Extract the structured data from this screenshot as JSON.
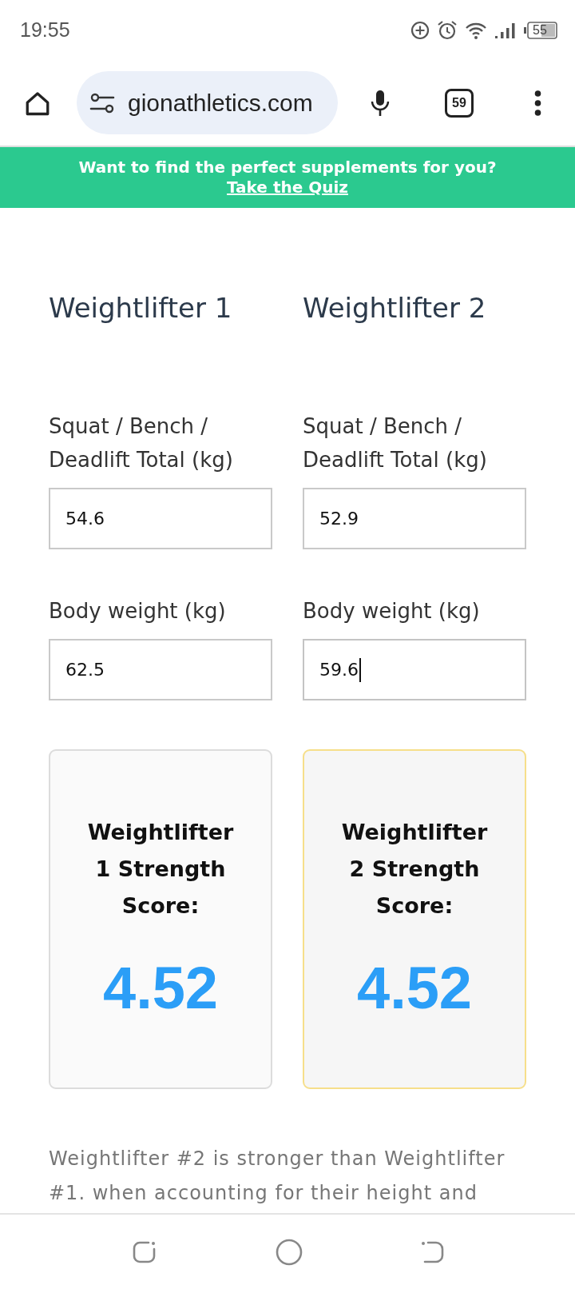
{
  "status_bar": {
    "time": "19:55",
    "battery": "55"
  },
  "browser": {
    "url": "gionathletics.com",
    "tab_count": "59"
  },
  "banner": {
    "text": "Want to find the perfect supplements for you?",
    "link": "Take the Quiz"
  },
  "lifters": [
    {
      "heading": "Weightlifter 1",
      "fields": [
        {
          "label": "Squat / Bench / Deadlift Total (kg)",
          "value": "54.6",
          "focused": false
        },
        {
          "label": "Body weight (kg)",
          "value": "62.5",
          "focused": false
        }
      ],
      "result": {
        "title": "Weightlifter 1 Strength Score:",
        "score": "4.52",
        "highlighted": false
      }
    },
    {
      "heading": "Weightlifter 2",
      "fields": [
        {
          "label": "Squat / Bench / Deadlift Total (kg)",
          "value": "52.9",
          "focused": false
        },
        {
          "label": "Body weight (kg)",
          "value": "59.6",
          "focused": true
        }
      ],
      "result": {
        "title": "Weightlifter 2 Strength Score:",
        "score": "4.52",
        "highlighted": true
      }
    }
  ],
  "summary": "Weightlifter #2 is stronger than Weightlifter #1. when accounting for their height and"
}
